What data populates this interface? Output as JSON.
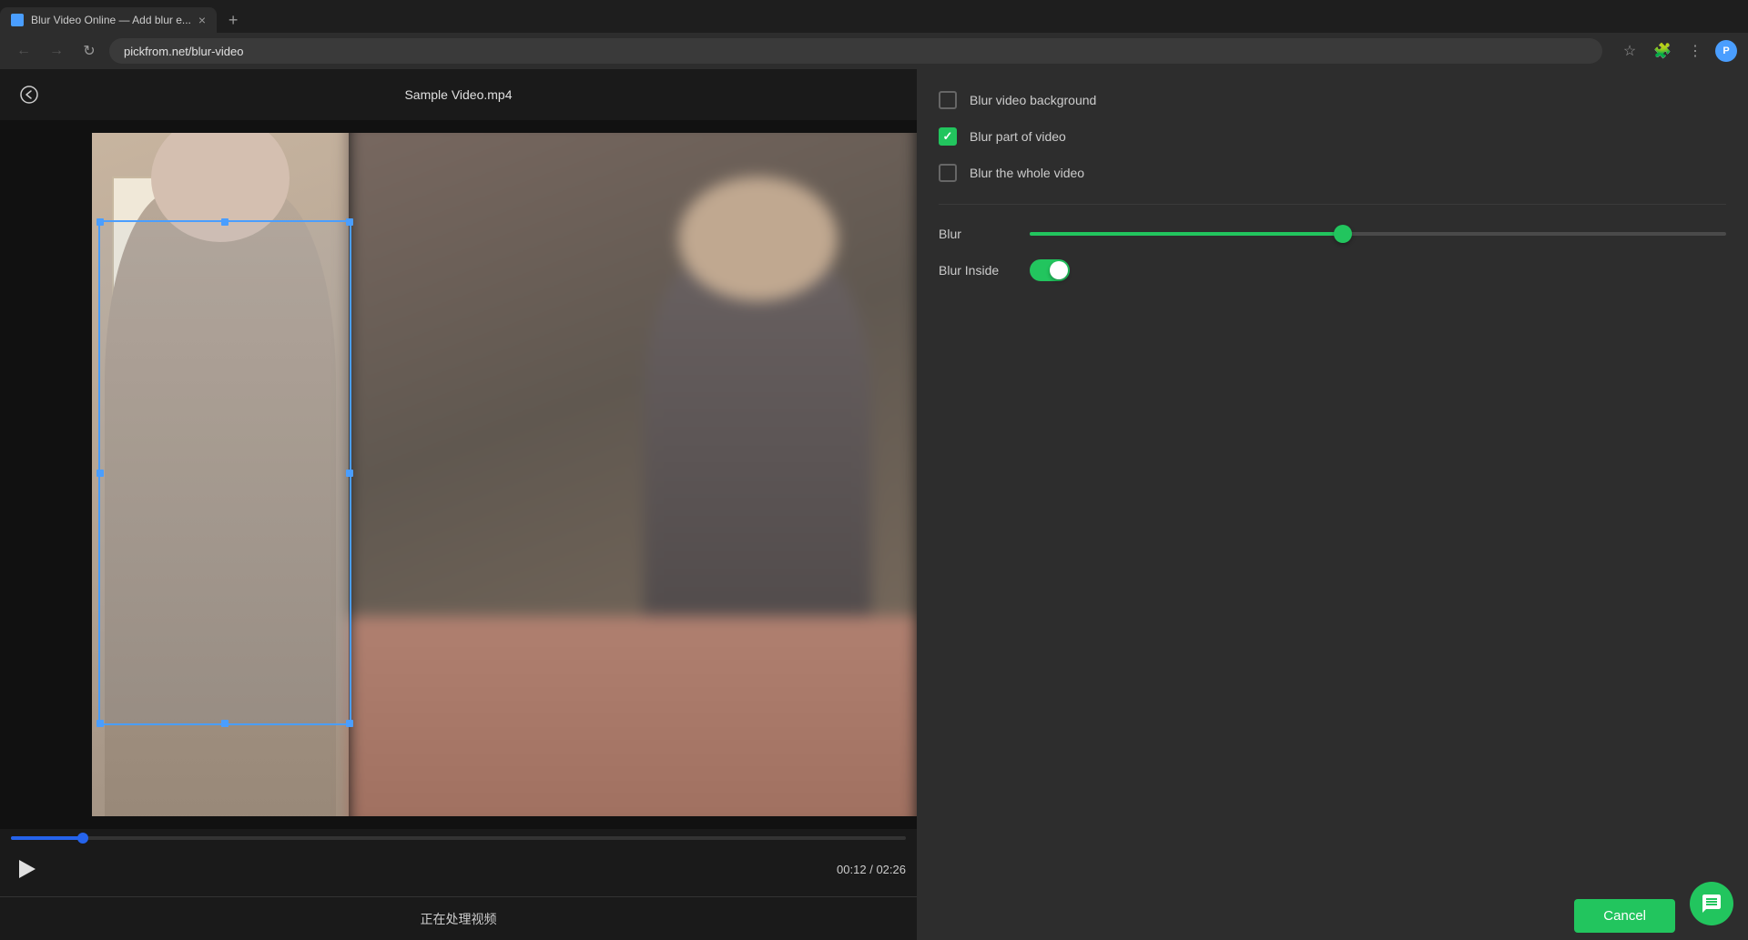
{
  "browser": {
    "tab_title": "Blur Video Online — Add blur e...",
    "tab_favicon_color": "#4a9eff",
    "address": "pickfrom.net/blur-video",
    "add_tab_label": "+",
    "nav": {
      "back": "←",
      "forward": "→",
      "reload": "↻"
    }
  },
  "header": {
    "back_icon": "←",
    "video_title": "Sample Video.mp4"
  },
  "controls": {
    "blur_background_label": "Blur video background",
    "blur_background_checked": false,
    "blur_part_label": "Blur part of video",
    "blur_part_checked": true,
    "blur_whole_label": "Blur the whole video",
    "blur_whole_checked": false,
    "blur_slider_label": "Blur",
    "blur_slider_value": 45,
    "blur_inside_label": "Blur Inside",
    "blur_inside_on": true
  },
  "video": {
    "time_current": "00:12",
    "time_total": "02:26",
    "progress_percent": 8
  },
  "bottom": {
    "processing_text": "正在处理视频",
    "cancel_label": "Cancel"
  },
  "icons": {
    "play": "▶",
    "back": "❮",
    "chat": "💬"
  }
}
